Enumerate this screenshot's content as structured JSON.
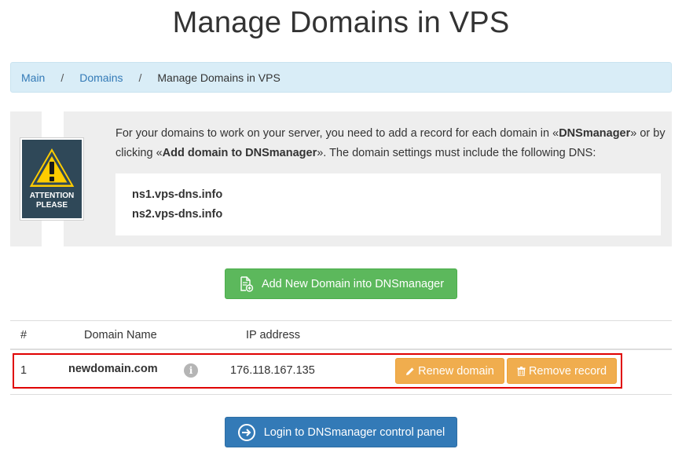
{
  "page": {
    "title": "Manage Domains in VPS"
  },
  "breadcrumb": {
    "items": [
      {
        "label": "Main"
      },
      {
        "label": "Domains"
      },
      {
        "label": "Manage Domains in VPS"
      }
    ],
    "separator": "/"
  },
  "notice": {
    "badge_line1": "ATTENTION",
    "badge_line2": "PLEASE",
    "text_part1": "For your domains to work on your server, you need to add a record for each domain in «",
    "text_bold1": "DNSmanager",
    "text_part2": "» or by clicking «",
    "text_bold2": "Add domain to DNSmanager",
    "text_part3": "». The domain settings must include the following DNS:",
    "dns_servers": [
      "ns1.vps-dns.info",
      "ns2.vps-dns.info"
    ]
  },
  "actions": {
    "add_domain_label": "Add New Domain into DNSmanager",
    "login_label": "Login to DNSmanager control panel"
  },
  "table": {
    "columns": [
      "#",
      "Domain Name",
      "IP address"
    ],
    "rows": [
      {
        "index": "1",
        "domain": "newdomain.com",
        "info_icon": "i",
        "ip": "176.118.167.135",
        "renew_label": "Renew domain",
        "remove_label": "Remove record"
      }
    ]
  },
  "colors": {
    "success": "#5cb85c",
    "warning": "#f0ad4e",
    "primary": "#337ab7",
    "breadcrumb_bg": "#d9edf7",
    "highlight": "#e00000"
  },
  "icons": {
    "badge": "warning-triangle-icon",
    "add": "add-document-icon",
    "renew": "pencil-icon",
    "remove": "trash-icon",
    "login": "arrow-circle-right-icon",
    "info": "info-circle-icon"
  }
}
